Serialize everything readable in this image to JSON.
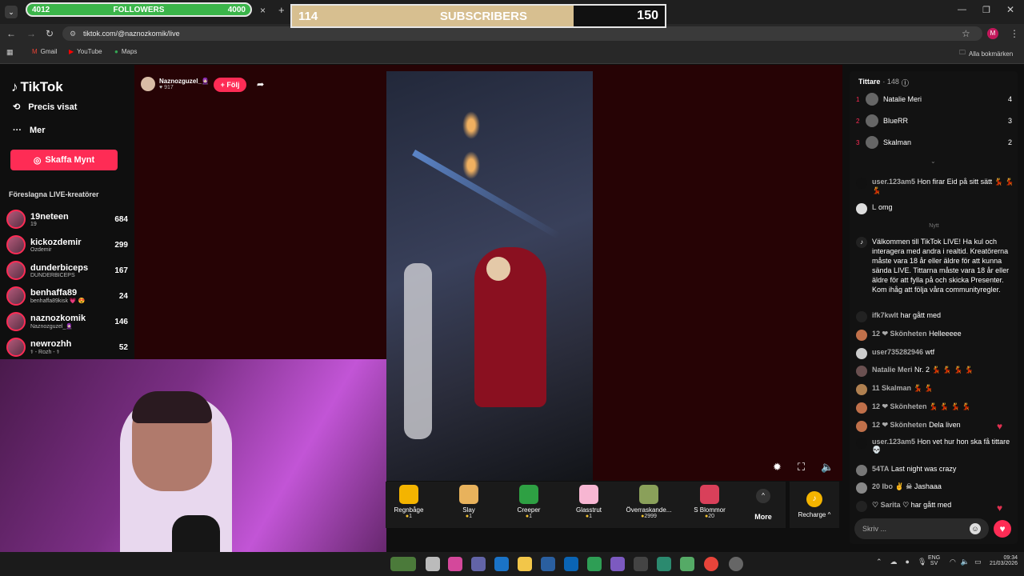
{
  "browser": {
    "tab_close": "×",
    "tab_add": "+",
    "url": "tiktok.com/@naznozkomik/live",
    "bookmarks": [
      "Gmail",
      "YouTube",
      "Maps"
    ],
    "all_bookmarks": "Alla bokmärken",
    "profile_letter": "M"
  },
  "overlay": {
    "followers_current": "4012",
    "followers_label": "FOLLOWERS",
    "followers_goal": "4000",
    "subs_current": "114",
    "subs_label": "SUBSCRIBERS",
    "subs_goal": "150"
  },
  "sidebar": {
    "logo": "TikTok",
    "nav": [
      {
        "label": "Precis visat",
        "icon": "history-icon"
      },
      {
        "label": "Mer",
        "icon": "more-icon"
      }
    ],
    "coins_button": "Skaffa Mynt",
    "suggested_title": "Föreslagna LIVE-kreatörer",
    "creators": [
      {
        "name": "19neteen",
        "sub": "19",
        "count": "684"
      },
      {
        "name": "kickozdemir",
        "sub": "Ozdemir",
        "count": "299"
      },
      {
        "name": "dunderbiceps",
        "sub": "DUNDERBICEPS",
        "count": "167"
      },
      {
        "name": "benhaffa89",
        "sub": "benhaffa89kisk 💗 😍",
        "count": "24"
      },
      {
        "name": "naznozkomik",
        "sub": "Naznozguzel_🧕🏻",
        "count": "146"
      },
      {
        "name": "newrozhh",
        "sub": "⚕ - Rozh - ⚕",
        "count": "52"
      }
    ]
  },
  "stream": {
    "host_name": "Naznozguzel_🧕🏻",
    "host_likes": "917",
    "follow_label": "+ Följ"
  },
  "gifts": [
    {
      "name": "Regnbåge",
      "price": "1",
      "color": "#f4b400"
    },
    {
      "name": "Slay",
      "price": "1",
      "color": "#e8b25c"
    },
    {
      "name": "Creeper",
      "price": "1",
      "color": "#2ea043"
    },
    {
      "name": "Glasstrut",
      "price": "1",
      "color": "#f7b6d2"
    },
    {
      "name": "Överraskande...",
      "price": "2999",
      "color": "#8aa05a"
    },
    {
      "name": "S Blommor",
      "price": "20",
      "color": "#d9405a"
    }
  ],
  "gifts_more": "More",
  "recharge": "Recharge ^",
  "chat": {
    "viewers_title": "Tittare",
    "viewers_count": "· 148",
    "top_viewers": [
      {
        "rank": "1",
        "name": "Natalie Meri",
        "score": "4"
      },
      {
        "rank": "2",
        "name": "BlueRR",
        "score": "3"
      },
      {
        "rank": "3",
        "name": "Skalman",
        "score": "2"
      }
    ],
    "new_label": "Nytt",
    "messages": [
      {
        "user": "user.123am5",
        "text": "Hon firar Eid på sitt sätt 💃 💃 💃"
      },
      {
        "user": "L",
        "text": "omg"
      },
      {
        "user": "",
        "text": "Välkommen till TikTok LIVE! Ha kul och interagera med andra i realtid. Kreatörerna måste vara 18 år eller äldre för att kunna sända LIVE. Tittarna måste vara 18 år eller äldre för att fylla på och skicka Presenter. Kom ihåg att följa våra communityregler."
      },
      {
        "user": "ifk7kwlt",
        "text": "har gått med"
      },
      {
        "user": "12 ❤ Skönheten",
        "text": "Helleeeee"
      },
      {
        "user": "user735282946",
        "text": "wtf"
      },
      {
        "user": "Natalie Meri",
        "text": "Nr. 2 💃 💃 💃 💃"
      },
      {
        "user": "11 Skalman",
        "text": "💃 💃"
      },
      {
        "user": "12 ❤ Skönheten",
        "text": "💃 💃 💃 💃"
      },
      {
        "user": "12 ❤ Skönheten",
        "text": "Dela liven"
      },
      {
        "user": "user.123am5",
        "text": "Hon vet hur hon ska få tittare 💀"
      },
      {
        "user": "54TA",
        "text": "Last night was crazy"
      },
      {
        "user": "20 Ibo ✌ ☠",
        "text": "Jashaaa"
      },
      {
        "user": "♡ Sarita ♡",
        "text": "har gått med"
      }
    ],
    "input_placeholder": "Skriv ..."
  },
  "taskbar": {
    "lang": "ENG",
    "region": "SV",
    "time": "09:34",
    "date": "21/03/2026"
  }
}
